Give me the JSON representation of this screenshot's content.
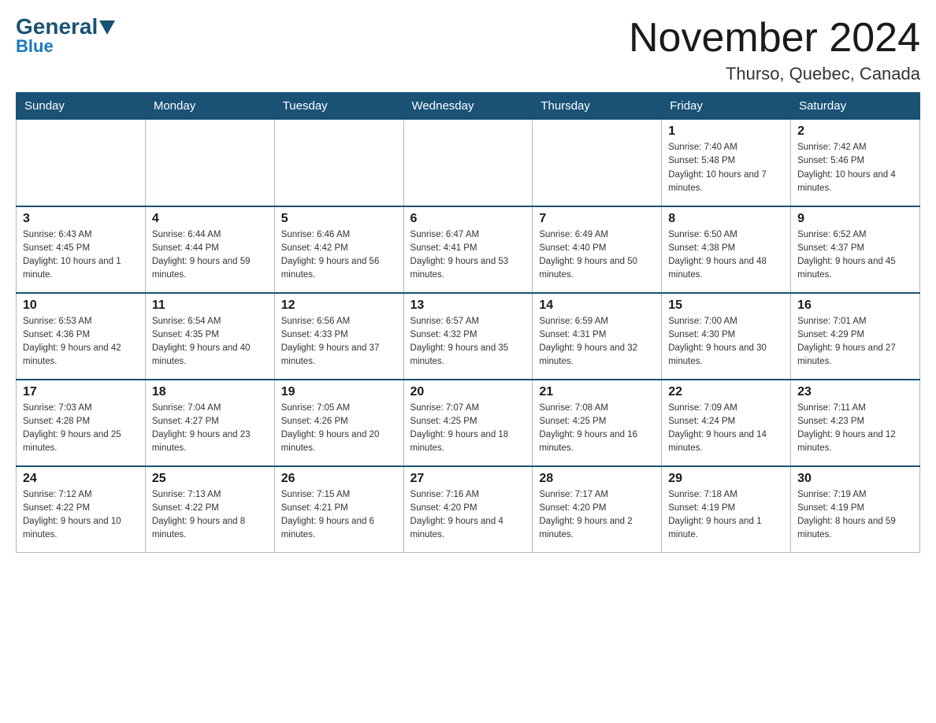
{
  "header": {
    "logo_general": "General",
    "logo_blue": "Blue",
    "month_title": "November 2024",
    "location": "Thurso, Quebec, Canada"
  },
  "weekdays": [
    "Sunday",
    "Monday",
    "Tuesday",
    "Wednesday",
    "Thursday",
    "Friday",
    "Saturday"
  ],
  "weeks": [
    [
      {
        "day": "",
        "sunrise": "",
        "sunset": "",
        "daylight": ""
      },
      {
        "day": "",
        "sunrise": "",
        "sunset": "",
        "daylight": ""
      },
      {
        "day": "",
        "sunrise": "",
        "sunset": "",
        "daylight": ""
      },
      {
        "day": "",
        "sunrise": "",
        "sunset": "",
        "daylight": ""
      },
      {
        "day": "",
        "sunrise": "",
        "sunset": "",
        "daylight": ""
      },
      {
        "day": "1",
        "sunrise": "Sunrise: 7:40 AM",
        "sunset": "Sunset: 5:48 PM",
        "daylight": "Daylight: 10 hours and 7 minutes."
      },
      {
        "day": "2",
        "sunrise": "Sunrise: 7:42 AM",
        "sunset": "Sunset: 5:46 PM",
        "daylight": "Daylight: 10 hours and 4 minutes."
      }
    ],
    [
      {
        "day": "3",
        "sunrise": "Sunrise: 6:43 AM",
        "sunset": "Sunset: 4:45 PM",
        "daylight": "Daylight: 10 hours and 1 minute."
      },
      {
        "day": "4",
        "sunrise": "Sunrise: 6:44 AM",
        "sunset": "Sunset: 4:44 PM",
        "daylight": "Daylight: 9 hours and 59 minutes."
      },
      {
        "day": "5",
        "sunrise": "Sunrise: 6:46 AM",
        "sunset": "Sunset: 4:42 PM",
        "daylight": "Daylight: 9 hours and 56 minutes."
      },
      {
        "day": "6",
        "sunrise": "Sunrise: 6:47 AM",
        "sunset": "Sunset: 4:41 PM",
        "daylight": "Daylight: 9 hours and 53 minutes."
      },
      {
        "day": "7",
        "sunrise": "Sunrise: 6:49 AM",
        "sunset": "Sunset: 4:40 PM",
        "daylight": "Daylight: 9 hours and 50 minutes."
      },
      {
        "day": "8",
        "sunrise": "Sunrise: 6:50 AM",
        "sunset": "Sunset: 4:38 PM",
        "daylight": "Daylight: 9 hours and 48 minutes."
      },
      {
        "day": "9",
        "sunrise": "Sunrise: 6:52 AM",
        "sunset": "Sunset: 4:37 PM",
        "daylight": "Daylight: 9 hours and 45 minutes."
      }
    ],
    [
      {
        "day": "10",
        "sunrise": "Sunrise: 6:53 AM",
        "sunset": "Sunset: 4:36 PM",
        "daylight": "Daylight: 9 hours and 42 minutes."
      },
      {
        "day": "11",
        "sunrise": "Sunrise: 6:54 AM",
        "sunset": "Sunset: 4:35 PM",
        "daylight": "Daylight: 9 hours and 40 minutes."
      },
      {
        "day": "12",
        "sunrise": "Sunrise: 6:56 AM",
        "sunset": "Sunset: 4:33 PM",
        "daylight": "Daylight: 9 hours and 37 minutes."
      },
      {
        "day": "13",
        "sunrise": "Sunrise: 6:57 AM",
        "sunset": "Sunset: 4:32 PM",
        "daylight": "Daylight: 9 hours and 35 minutes."
      },
      {
        "day": "14",
        "sunrise": "Sunrise: 6:59 AM",
        "sunset": "Sunset: 4:31 PM",
        "daylight": "Daylight: 9 hours and 32 minutes."
      },
      {
        "day": "15",
        "sunrise": "Sunrise: 7:00 AM",
        "sunset": "Sunset: 4:30 PM",
        "daylight": "Daylight: 9 hours and 30 minutes."
      },
      {
        "day": "16",
        "sunrise": "Sunrise: 7:01 AM",
        "sunset": "Sunset: 4:29 PM",
        "daylight": "Daylight: 9 hours and 27 minutes."
      }
    ],
    [
      {
        "day": "17",
        "sunrise": "Sunrise: 7:03 AM",
        "sunset": "Sunset: 4:28 PM",
        "daylight": "Daylight: 9 hours and 25 minutes."
      },
      {
        "day": "18",
        "sunrise": "Sunrise: 7:04 AM",
        "sunset": "Sunset: 4:27 PM",
        "daylight": "Daylight: 9 hours and 23 minutes."
      },
      {
        "day": "19",
        "sunrise": "Sunrise: 7:05 AM",
        "sunset": "Sunset: 4:26 PM",
        "daylight": "Daylight: 9 hours and 20 minutes."
      },
      {
        "day": "20",
        "sunrise": "Sunrise: 7:07 AM",
        "sunset": "Sunset: 4:25 PM",
        "daylight": "Daylight: 9 hours and 18 minutes."
      },
      {
        "day": "21",
        "sunrise": "Sunrise: 7:08 AM",
        "sunset": "Sunset: 4:25 PM",
        "daylight": "Daylight: 9 hours and 16 minutes."
      },
      {
        "day": "22",
        "sunrise": "Sunrise: 7:09 AM",
        "sunset": "Sunset: 4:24 PM",
        "daylight": "Daylight: 9 hours and 14 minutes."
      },
      {
        "day": "23",
        "sunrise": "Sunrise: 7:11 AM",
        "sunset": "Sunset: 4:23 PM",
        "daylight": "Daylight: 9 hours and 12 minutes."
      }
    ],
    [
      {
        "day": "24",
        "sunrise": "Sunrise: 7:12 AM",
        "sunset": "Sunset: 4:22 PM",
        "daylight": "Daylight: 9 hours and 10 minutes."
      },
      {
        "day": "25",
        "sunrise": "Sunrise: 7:13 AM",
        "sunset": "Sunset: 4:22 PM",
        "daylight": "Daylight: 9 hours and 8 minutes."
      },
      {
        "day": "26",
        "sunrise": "Sunrise: 7:15 AM",
        "sunset": "Sunset: 4:21 PM",
        "daylight": "Daylight: 9 hours and 6 minutes."
      },
      {
        "day": "27",
        "sunrise": "Sunrise: 7:16 AM",
        "sunset": "Sunset: 4:20 PM",
        "daylight": "Daylight: 9 hours and 4 minutes."
      },
      {
        "day": "28",
        "sunrise": "Sunrise: 7:17 AM",
        "sunset": "Sunset: 4:20 PM",
        "daylight": "Daylight: 9 hours and 2 minutes."
      },
      {
        "day": "29",
        "sunrise": "Sunrise: 7:18 AM",
        "sunset": "Sunset: 4:19 PM",
        "daylight": "Daylight: 9 hours and 1 minute."
      },
      {
        "day": "30",
        "sunrise": "Sunrise: 7:19 AM",
        "sunset": "Sunset: 4:19 PM",
        "daylight": "Daylight: 8 hours and 59 minutes."
      }
    ]
  ]
}
